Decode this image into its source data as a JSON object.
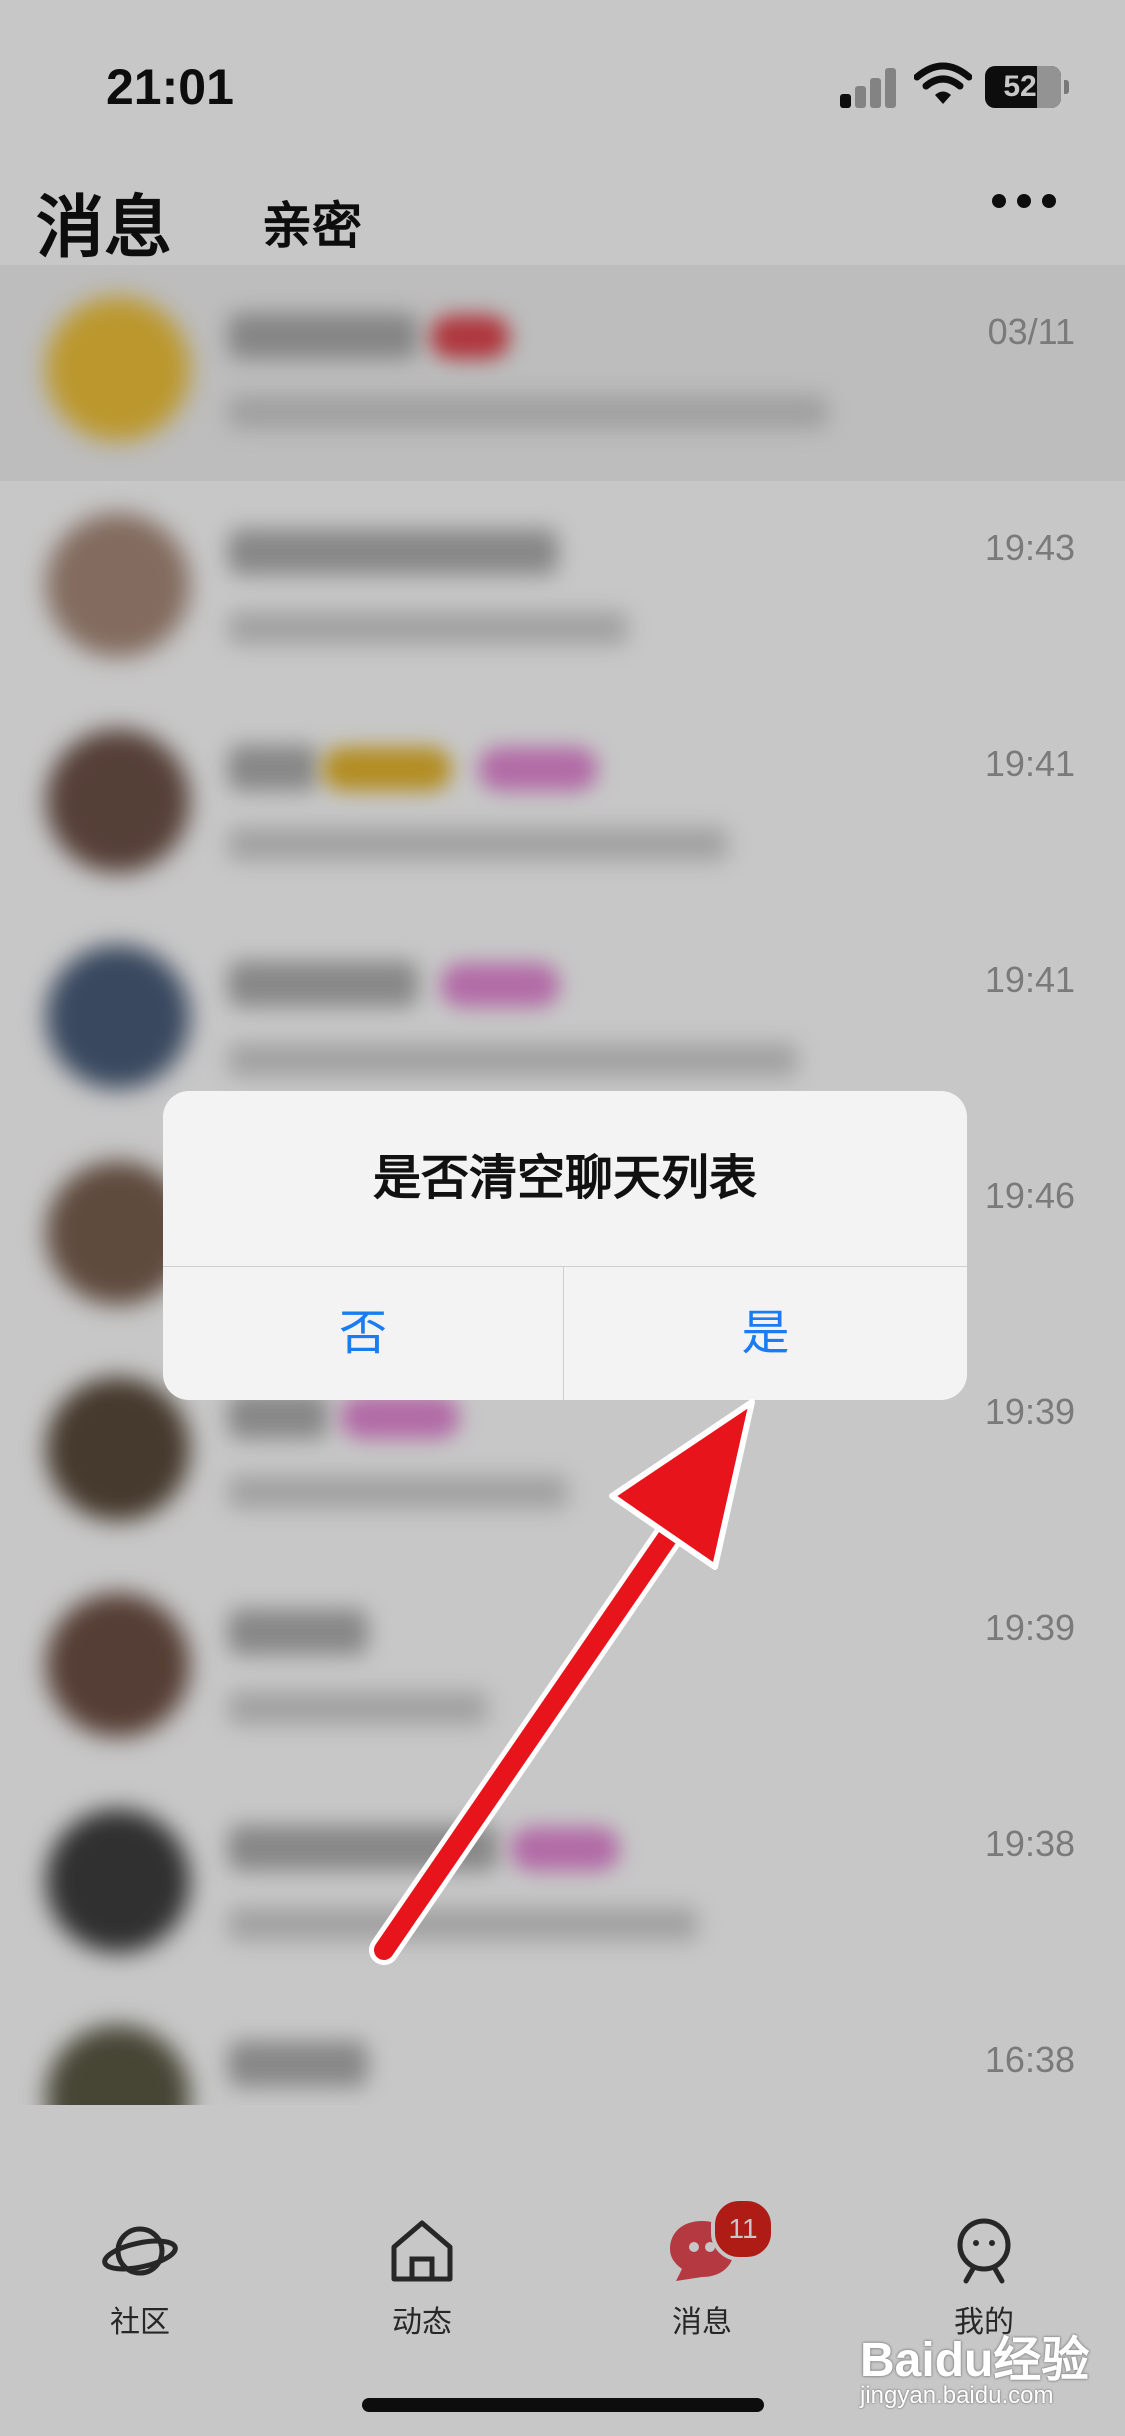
{
  "status_bar": {
    "time": "21:01",
    "battery": "52"
  },
  "header": {
    "title": "消息",
    "tab_intimate": "亲密"
  },
  "chat_list": [
    {
      "time": "03/11"
    },
    {
      "time": "19:43"
    },
    {
      "time": "19:41"
    },
    {
      "time": "19:41"
    },
    {
      "time": "19:46"
    },
    {
      "time": "19:39"
    },
    {
      "time": "19:39"
    },
    {
      "time": "19:38"
    },
    {
      "time": "16:38"
    }
  ],
  "dialog": {
    "title": "是否清空聊天列表",
    "no_label": "否",
    "yes_label": "是"
  },
  "tab_bar": {
    "items": [
      {
        "label": "社区",
        "icon": "planet-icon"
      },
      {
        "label": "动态",
        "icon": "home-icon"
      },
      {
        "label": "消息",
        "icon": "chat-bubble-icon",
        "badge": "11"
      },
      {
        "label": "我的",
        "icon": "profile-icon"
      }
    ]
  },
  "watermark": {
    "logo": "Baidu经验",
    "url": "jingyan.baidu.com"
  },
  "colors": {
    "accent_blue": "#1a7cf2",
    "badge_red": "#e1251b",
    "message_red": "#e84a54",
    "arrow_red": "#e8141c"
  }
}
